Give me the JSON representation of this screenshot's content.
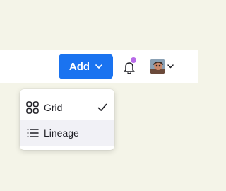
{
  "toolbar": {
    "add_label": "Add",
    "notification_badge_color": "#b86ae8",
    "accent_color": "#1a73f0"
  },
  "view_menu": {
    "items": [
      {
        "label": "Grid",
        "icon": "grid-icon",
        "selected": true
      },
      {
        "label": "Lineage",
        "icon": "list-icon",
        "selected": false
      }
    ]
  }
}
